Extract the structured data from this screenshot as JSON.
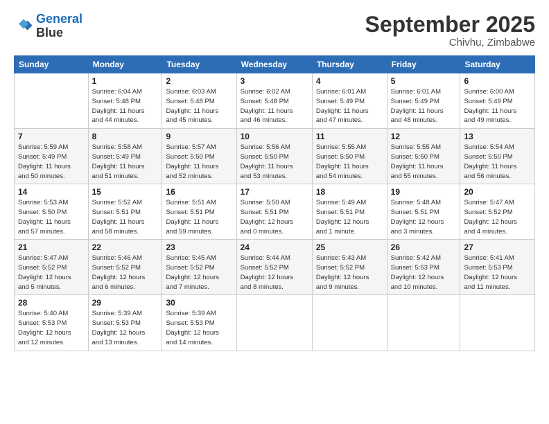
{
  "header": {
    "logo_line1": "General",
    "logo_line2": "Blue",
    "month": "September 2025",
    "location": "Chivhu, Zimbabwe"
  },
  "days_of_week": [
    "Sunday",
    "Monday",
    "Tuesday",
    "Wednesday",
    "Thursday",
    "Friday",
    "Saturday"
  ],
  "weeks": [
    [
      {
        "day": "",
        "info": ""
      },
      {
        "day": "1",
        "info": "Sunrise: 6:04 AM\nSunset: 5:48 PM\nDaylight: 11 hours\nand 44 minutes."
      },
      {
        "day": "2",
        "info": "Sunrise: 6:03 AM\nSunset: 5:48 PM\nDaylight: 11 hours\nand 45 minutes."
      },
      {
        "day": "3",
        "info": "Sunrise: 6:02 AM\nSunset: 5:48 PM\nDaylight: 11 hours\nand 46 minutes."
      },
      {
        "day": "4",
        "info": "Sunrise: 6:01 AM\nSunset: 5:49 PM\nDaylight: 11 hours\nand 47 minutes."
      },
      {
        "day": "5",
        "info": "Sunrise: 6:01 AM\nSunset: 5:49 PM\nDaylight: 11 hours\nand 48 minutes."
      },
      {
        "day": "6",
        "info": "Sunrise: 6:00 AM\nSunset: 5:49 PM\nDaylight: 11 hours\nand 49 minutes."
      }
    ],
    [
      {
        "day": "7",
        "info": "Sunrise: 5:59 AM\nSunset: 5:49 PM\nDaylight: 11 hours\nand 50 minutes."
      },
      {
        "day": "8",
        "info": "Sunrise: 5:58 AM\nSunset: 5:49 PM\nDaylight: 11 hours\nand 51 minutes."
      },
      {
        "day": "9",
        "info": "Sunrise: 5:57 AM\nSunset: 5:50 PM\nDaylight: 11 hours\nand 52 minutes."
      },
      {
        "day": "10",
        "info": "Sunrise: 5:56 AM\nSunset: 5:50 PM\nDaylight: 11 hours\nand 53 minutes."
      },
      {
        "day": "11",
        "info": "Sunrise: 5:55 AM\nSunset: 5:50 PM\nDaylight: 11 hours\nand 54 minutes."
      },
      {
        "day": "12",
        "info": "Sunrise: 5:55 AM\nSunset: 5:50 PM\nDaylight: 11 hours\nand 55 minutes."
      },
      {
        "day": "13",
        "info": "Sunrise: 5:54 AM\nSunset: 5:50 PM\nDaylight: 11 hours\nand 56 minutes."
      }
    ],
    [
      {
        "day": "14",
        "info": "Sunrise: 5:53 AM\nSunset: 5:50 PM\nDaylight: 11 hours\nand 57 minutes."
      },
      {
        "day": "15",
        "info": "Sunrise: 5:52 AM\nSunset: 5:51 PM\nDaylight: 11 hours\nand 58 minutes."
      },
      {
        "day": "16",
        "info": "Sunrise: 5:51 AM\nSunset: 5:51 PM\nDaylight: 11 hours\nand 59 minutes."
      },
      {
        "day": "17",
        "info": "Sunrise: 5:50 AM\nSunset: 5:51 PM\nDaylight: 12 hours\nand 0 minutes."
      },
      {
        "day": "18",
        "info": "Sunrise: 5:49 AM\nSunset: 5:51 PM\nDaylight: 12 hours\nand 1 minute."
      },
      {
        "day": "19",
        "info": "Sunrise: 5:48 AM\nSunset: 5:51 PM\nDaylight: 12 hours\nand 3 minutes."
      },
      {
        "day": "20",
        "info": "Sunrise: 5:47 AM\nSunset: 5:52 PM\nDaylight: 12 hours\nand 4 minutes."
      }
    ],
    [
      {
        "day": "21",
        "info": "Sunrise: 5:47 AM\nSunset: 5:52 PM\nDaylight: 12 hours\nand 5 minutes."
      },
      {
        "day": "22",
        "info": "Sunrise: 5:46 AM\nSunset: 5:52 PM\nDaylight: 12 hours\nand 6 minutes."
      },
      {
        "day": "23",
        "info": "Sunrise: 5:45 AM\nSunset: 5:52 PM\nDaylight: 12 hours\nand 7 minutes."
      },
      {
        "day": "24",
        "info": "Sunrise: 5:44 AM\nSunset: 5:52 PM\nDaylight: 12 hours\nand 8 minutes."
      },
      {
        "day": "25",
        "info": "Sunrise: 5:43 AM\nSunset: 5:52 PM\nDaylight: 12 hours\nand 9 minutes."
      },
      {
        "day": "26",
        "info": "Sunrise: 5:42 AM\nSunset: 5:53 PM\nDaylight: 12 hours\nand 10 minutes."
      },
      {
        "day": "27",
        "info": "Sunrise: 5:41 AM\nSunset: 5:53 PM\nDaylight: 12 hours\nand 11 minutes."
      }
    ],
    [
      {
        "day": "28",
        "info": "Sunrise: 5:40 AM\nSunset: 5:53 PM\nDaylight: 12 hours\nand 12 minutes."
      },
      {
        "day": "29",
        "info": "Sunrise: 5:39 AM\nSunset: 5:53 PM\nDaylight: 12 hours\nand 13 minutes."
      },
      {
        "day": "30",
        "info": "Sunrise: 5:39 AM\nSunset: 5:53 PM\nDaylight: 12 hours\nand 14 minutes."
      },
      {
        "day": "",
        "info": ""
      },
      {
        "day": "",
        "info": ""
      },
      {
        "day": "",
        "info": ""
      },
      {
        "day": "",
        "info": ""
      }
    ]
  ]
}
